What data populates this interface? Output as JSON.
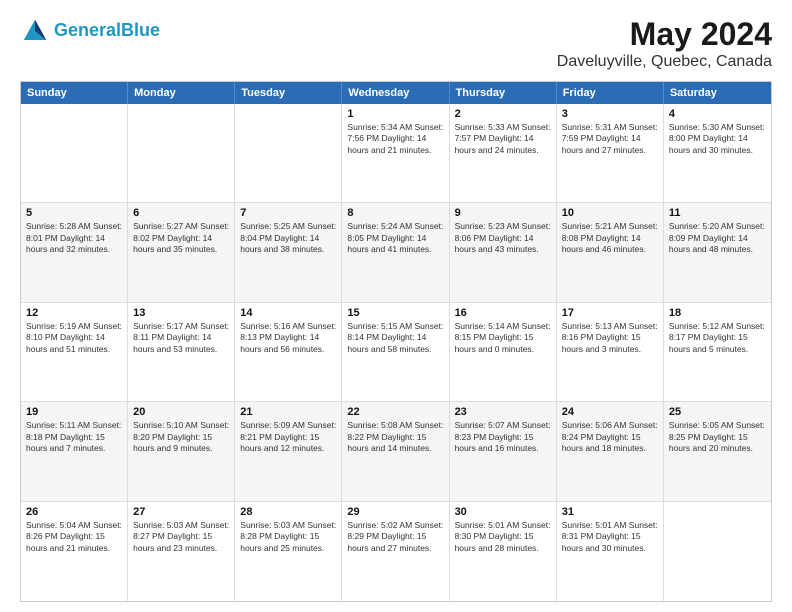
{
  "header": {
    "logo_line1": "General",
    "logo_line2": "Blue",
    "main_title": "May 2024",
    "subtitle": "Daveluyville, Quebec, Canada"
  },
  "days_of_week": [
    "Sunday",
    "Monday",
    "Tuesday",
    "Wednesday",
    "Thursday",
    "Friday",
    "Saturday"
  ],
  "weeks": [
    [
      {
        "day": "",
        "text": ""
      },
      {
        "day": "",
        "text": ""
      },
      {
        "day": "",
        "text": ""
      },
      {
        "day": "1",
        "text": "Sunrise: 5:34 AM\nSunset: 7:56 PM\nDaylight: 14 hours\nand 21 minutes."
      },
      {
        "day": "2",
        "text": "Sunrise: 5:33 AM\nSunset: 7:57 PM\nDaylight: 14 hours\nand 24 minutes."
      },
      {
        "day": "3",
        "text": "Sunrise: 5:31 AM\nSunset: 7:59 PM\nDaylight: 14 hours\nand 27 minutes."
      },
      {
        "day": "4",
        "text": "Sunrise: 5:30 AM\nSunset: 8:00 PM\nDaylight: 14 hours\nand 30 minutes."
      }
    ],
    [
      {
        "day": "5",
        "text": "Sunrise: 5:28 AM\nSunset: 8:01 PM\nDaylight: 14 hours\nand 32 minutes."
      },
      {
        "day": "6",
        "text": "Sunrise: 5:27 AM\nSunset: 8:02 PM\nDaylight: 14 hours\nand 35 minutes."
      },
      {
        "day": "7",
        "text": "Sunrise: 5:25 AM\nSunset: 8:04 PM\nDaylight: 14 hours\nand 38 minutes."
      },
      {
        "day": "8",
        "text": "Sunrise: 5:24 AM\nSunset: 8:05 PM\nDaylight: 14 hours\nand 41 minutes."
      },
      {
        "day": "9",
        "text": "Sunrise: 5:23 AM\nSunset: 8:06 PM\nDaylight: 14 hours\nand 43 minutes."
      },
      {
        "day": "10",
        "text": "Sunrise: 5:21 AM\nSunset: 8:08 PM\nDaylight: 14 hours\nand 46 minutes."
      },
      {
        "day": "11",
        "text": "Sunrise: 5:20 AM\nSunset: 8:09 PM\nDaylight: 14 hours\nand 48 minutes."
      }
    ],
    [
      {
        "day": "12",
        "text": "Sunrise: 5:19 AM\nSunset: 8:10 PM\nDaylight: 14 hours\nand 51 minutes."
      },
      {
        "day": "13",
        "text": "Sunrise: 5:17 AM\nSunset: 8:11 PM\nDaylight: 14 hours\nand 53 minutes."
      },
      {
        "day": "14",
        "text": "Sunrise: 5:16 AM\nSunset: 8:13 PM\nDaylight: 14 hours\nand 56 minutes."
      },
      {
        "day": "15",
        "text": "Sunrise: 5:15 AM\nSunset: 8:14 PM\nDaylight: 14 hours\nand 58 minutes."
      },
      {
        "day": "16",
        "text": "Sunrise: 5:14 AM\nSunset: 8:15 PM\nDaylight: 15 hours\nand 0 minutes."
      },
      {
        "day": "17",
        "text": "Sunrise: 5:13 AM\nSunset: 8:16 PM\nDaylight: 15 hours\nand 3 minutes."
      },
      {
        "day": "18",
        "text": "Sunrise: 5:12 AM\nSunset: 8:17 PM\nDaylight: 15 hours\nand 5 minutes."
      }
    ],
    [
      {
        "day": "19",
        "text": "Sunrise: 5:11 AM\nSunset: 8:18 PM\nDaylight: 15 hours\nand 7 minutes."
      },
      {
        "day": "20",
        "text": "Sunrise: 5:10 AM\nSunset: 8:20 PM\nDaylight: 15 hours\nand 9 minutes."
      },
      {
        "day": "21",
        "text": "Sunrise: 5:09 AM\nSunset: 8:21 PM\nDaylight: 15 hours\nand 12 minutes."
      },
      {
        "day": "22",
        "text": "Sunrise: 5:08 AM\nSunset: 8:22 PM\nDaylight: 15 hours\nand 14 minutes."
      },
      {
        "day": "23",
        "text": "Sunrise: 5:07 AM\nSunset: 8:23 PM\nDaylight: 15 hours\nand 16 minutes."
      },
      {
        "day": "24",
        "text": "Sunrise: 5:06 AM\nSunset: 8:24 PM\nDaylight: 15 hours\nand 18 minutes."
      },
      {
        "day": "25",
        "text": "Sunrise: 5:05 AM\nSunset: 8:25 PM\nDaylight: 15 hours\nand 20 minutes."
      }
    ],
    [
      {
        "day": "26",
        "text": "Sunrise: 5:04 AM\nSunset: 8:26 PM\nDaylight: 15 hours\nand 21 minutes."
      },
      {
        "day": "27",
        "text": "Sunrise: 5:03 AM\nSunset: 8:27 PM\nDaylight: 15 hours\nand 23 minutes."
      },
      {
        "day": "28",
        "text": "Sunrise: 5:03 AM\nSunset: 8:28 PM\nDaylight: 15 hours\nand 25 minutes."
      },
      {
        "day": "29",
        "text": "Sunrise: 5:02 AM\nSunset: 8:29 PM\nDaylight: 15 hours\nand 27 minutes."
      },
      {
        "day": "30",
        "text": "Sunrise: 5:01 AM\nSunset: 8:30 PM\nDaylight: 15 hours\nand 28 minutes."
      },
      {
        "day": "31",
        "text": "Sunrise: 5:01 AM\nSunset: 8:31 PM\nDaylight: 15 hours\nand 30 minutes."
      },
      {
        "day": "",
        "text": ""
      }
    ]
  ]
}
